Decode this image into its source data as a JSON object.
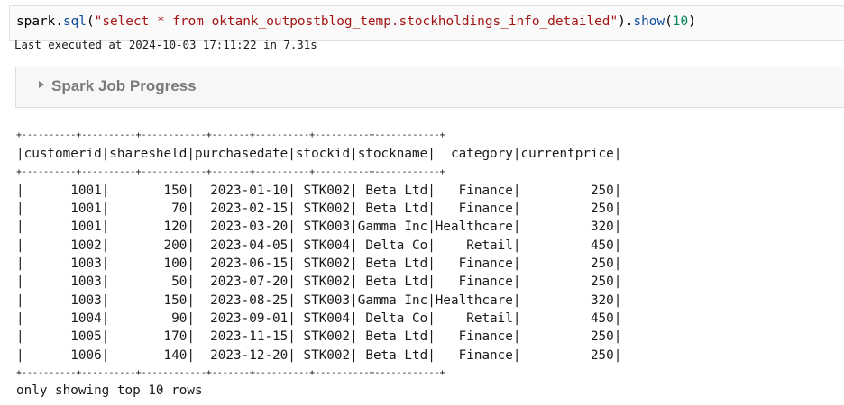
{
  "cell": {
    "code_prefix": "spark.",
    "code_fn1": "sql",
    "code_open": "(",
    "code_string": "\"select * from oktank_outpostblog_temp.stockholdings_info_detailed\"",
    "code_mid": ").",
    "code_fn2": "show",
    "code_open2": "(",
    "code_arg": "10",
    "code_close": ")",
    "exec_status": "Last executed at 2024-10-03 17:11:22 in 7.31s"
  },
  "spark_job": {
    "title": "Spark Job Progress",
    "collapsed": true
  },
  "table": {
    "separator": "+----------+----------+------------+-------+----------+----------+------------+",
    "header": "|customerid|sharesheld|purchasedate|stockid|stockname|  category|currentprice|",
    "columns": [
      "customerid",
      "sharesheld",
      "purchasedate",
      "stockid",
      "stockname",
      "category",
      "currentprice"
    ],
    "rows": [
      "|      1001|       150|  2023-01-10| STK002| Beta Ltd|   Finance|         250|",
      "|      1001|        70|  2023-02-15| STK002| Beta Ltd|   Finance|         250|",
      "|      1001|       120|  2023-03-20| STK003|Gamma Inc|Healthcare|         320|",
      "|      1002|       200|  2023-04-05| STK004| Delta Co|    Retail|         450|",
      "|      1003|       100|  2023-06-15| STK002| Beta Ltd|   Finance|         250|",
      "|      1003|        50|  2023-07-20| STK002| Beta Ltd|   Finance|         250|",
      "|      1003|       150|  2023-08-25| STK003|Gamma Inc|Healthcare|         320|",
      "|      1004|        90|  2023-09-01| STK004| Delta Co|    Retail|         450|",
      "|      1005|       170|  2023-11-15| STK002| Beta Ltd|   Finance|         250|",
      "|      1006|       140|  2023-12-20| STK002| Beta Ltd|   Finance|         250|"
    ],
    "footer": "only showing top 10 rows"
  }
}
